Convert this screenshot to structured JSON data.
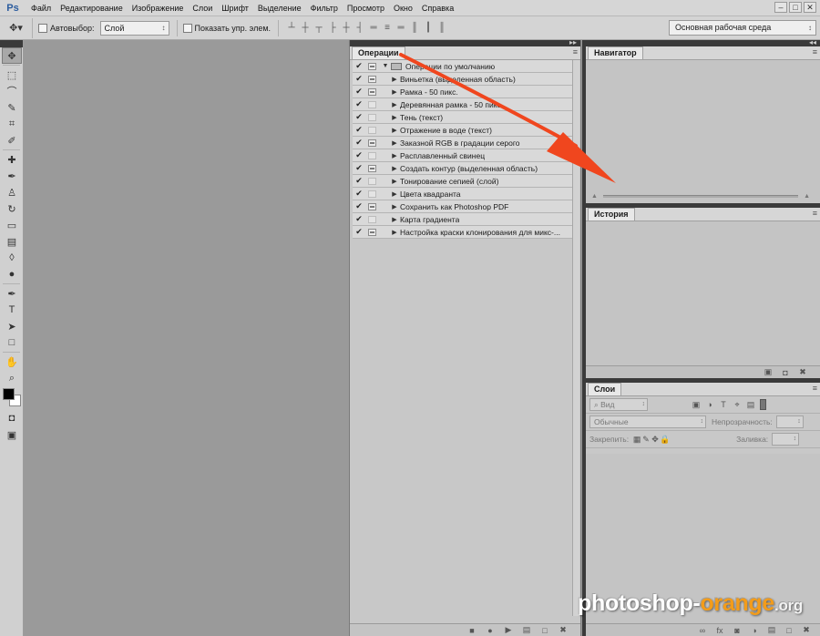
{
  "app": {
    "logo": "Ps",
    "menu": [
      "Файл",
      "Редактирование",
      "Изображение",
      "Слои",
      "Шрифт",
      "Выделение",
      "Фильтр",
      "Просмотр",
      "Окно",
      "Справка"
    ],
    "window_controls": [
      "–",
      "□",
      "✕"
    ]
  },
  "options_bar": {
    "autoselect_label": "Автовыбор:",
    "autoselect_value": "Слой",
    "show_transform_label": "Показать упр. элем.",
    "workspace": "Основная рабочая среда"
  },
  "operations_panel": {
    "tab": "Операции",
    "set_name": "Операции по умолчанию",
    "actions": [
      {
        "label": "Виньетка (выделенная область)",
        "dialog": true
      },
      {
        "label": "Рамка - 50 пикс.",
        "dialog": true
      },
      {
        "label": "Деревянная рамка - 50 пикс.",
        "dialog": false
      },
      {
        "label": "Тень (текст)",
        "dialog": false
      },
      {
        "label": "Отражение в воде (текст)",
        "dialog": false
      },
      {
        "label": "Заказной RGB в градации серого",
        "dialog": true
      },
      {
        "label": "Расплавленный свинец",
        "dialog": false
      },
      {
        "label": "Создать контур (выделенная область)",
        "dialog": true
      },
      {
        "label": "Тонирование сепией (слой)",
        "dialog": false
      },
      {
        "label": "Цвета квадранта",
        "dialog": false
      },
      {
        "label": "Сохранить как Photoshop PDF",
        "dialog": true
      },
      {
        "label": "Карта градиента",
        "dialog": false
      },
      {
        "label": "Настройка краски клонирования для микс-...",
        "dialog": true
      }
    ]
  },
  "navigator_panel": {
    "tab": "Навигатор"
  },
  "history_panel": {
    "tab": "История"
  },
  "layers_panel": {
    "tab": "Слои",
    "filter_placeholder": "Вид",
    "blend_mode": "Обычные",
    "opacity_label": "Непрозрачность:",
    "lock_label": "Закрепить:",
    "fill_label": "Заливка:"
  },
  "watermark": {
    "part1": "photoshop-",
    "part2": "orange",
    "part3": ".org"
  },
  "colors": {
    "arrow": "#f0461e",
    "watermark_accent": "#f39c1a"
  }
}
